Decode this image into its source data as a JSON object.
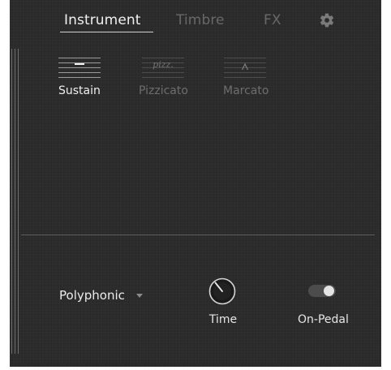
{
  "tabs": [
    {
      "label": "Instrument",
      "active": true
    },
    {
      "label": "Timbre",
      "active": false
    },
    {
      "label": "FX",
      "active": false
    }
  ],
  "settings_icon": "gear-icon",
  "articulations": [
    {
      "label": "Sustain",
      "symbol": "−",
      "selected": true
    },
    {
      "label": "Pizzicato",
      "symbol": "pizz.",
      "selected": false
    },
    {
      "label": "Marcato",
      "symbol": "∧",
      "selected": false
    }
  ],
  "controls": {
    "voice_mode": {
      "value": "Polyphonic",
      "icon": "chevron-down-icon"
    },
    "time_knob": {
      "label": "Time"
    },
    "pedal_toggle": {
      "label": "On-Pedal",
      "on": true
    }
  },
  "colors": {
    "panel_bg": "#2b2b2b",
    "active_text": "#f0f0f0",
    "inactive_text": "#686868"
  }
}
